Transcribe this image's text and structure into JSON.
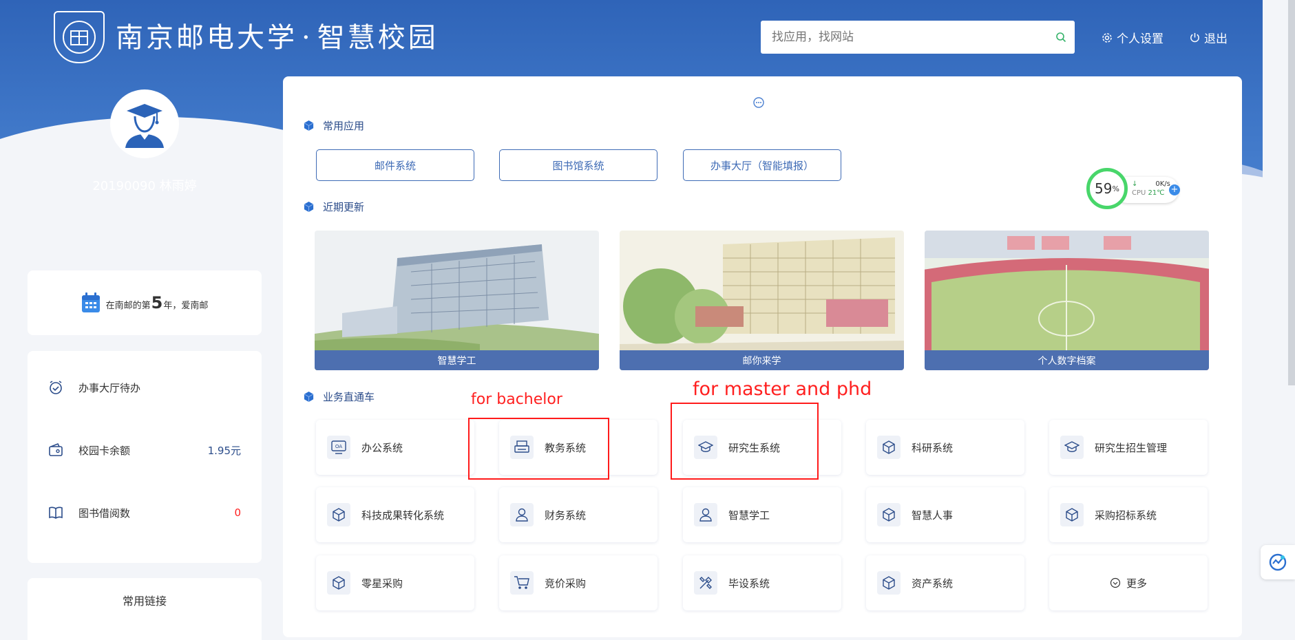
{
  "header": {
    "school_name": "南京邮电大学",
    "separator": "·",
    "portal_name": "智慧校园",
    "search_placeholder": "找应用，找网站",
    "settings_label": "个人设置",
    "logout_label": "退出"
  },
  "profile": {
    "user_line": "20190090 林雨婷",
    "years_prefix": "在南邮的第",
    "years_value": "5",
    "years_suffix": "年，爱南邮"
  },
  "stats": [
    {
      "label": "办事大厅待办",
      "value": "",
      "icon": "alarm-clock-icon"
    },
    {
      "label": "校园卡余额",
      "value": "1.95元",
      "icon": "wallet-icon"
    },
    {
      "label": "图书借阅数",
      "value": "0",
      "icon": "book-icon"
    }
  ],
  "links_title": "常用链接",
  "sections": {
    "common": "常用应用",
    "recent": "近期更新",
    "business": "业务直通车"
  },
  "common_apps": [
    "邮件系统",
    "图书馆系统",
    "办事大厅（智能填报）"
  ],
  "recent": [
    "智慧学工",
    "邮你来学",
    "个人数字档案"
  ],
  "business_apps": [
    {
      "label": "办公系统",
      "icon": "oa-icon"
    },
    {
      "label": "教务系统",
      "icon": "printer-icon"
    },
    {
      "label": "研究生系统",
      "icon": "graduation-cap-icon"
    },
    {
      "label": "科研系统",
      "icon": "cube-icon"
    },
    {
      "label": "研究生招生管理",
      "icon": "graduation-cap-icon"
    },
    {
      "label": "科技成果转化系统",
      "icon": "cube-icon"
    },
    {
      "label": "财务系统",
      "icon": "user-icon"
    },
    {
      "label": "智慧学工",
      "icon": "user-icon"
    },
    {
      "label": "智慧人事",
      "icon": "cube-icon"
    },
    {
      "label": "采购招标系统",
      "icon": "cube-icon"
    },
    {
      "label": "零星采购",
      "icon": "cube-icon"
    },
    {
      "label": "竞价采购",
      "icon": "cart-icon"
    },
    {
      "label": "毕设系统",
      "icon": "tools-icon"
    },
    {
      "label": "资产系统",
      "icon": "cube-icon"
    }
  ],
  "more_label": "更多",
  "annotations": {
    "bachelor": "for bachelor",
    "master": "for master and phd"
  },
  "widget": {
    "percent": "59",
    "percent_unit": "%",
    "net": "0K/s",
    "cpu_label": "CPU",
    "cpu_temp": "21℃"
  },
  "colors": {
    "brand_blue": "#3d6ab5",
    "annotation_red": "#ff1a1a",
    "widget_green": "#48d66a"
  }
}
